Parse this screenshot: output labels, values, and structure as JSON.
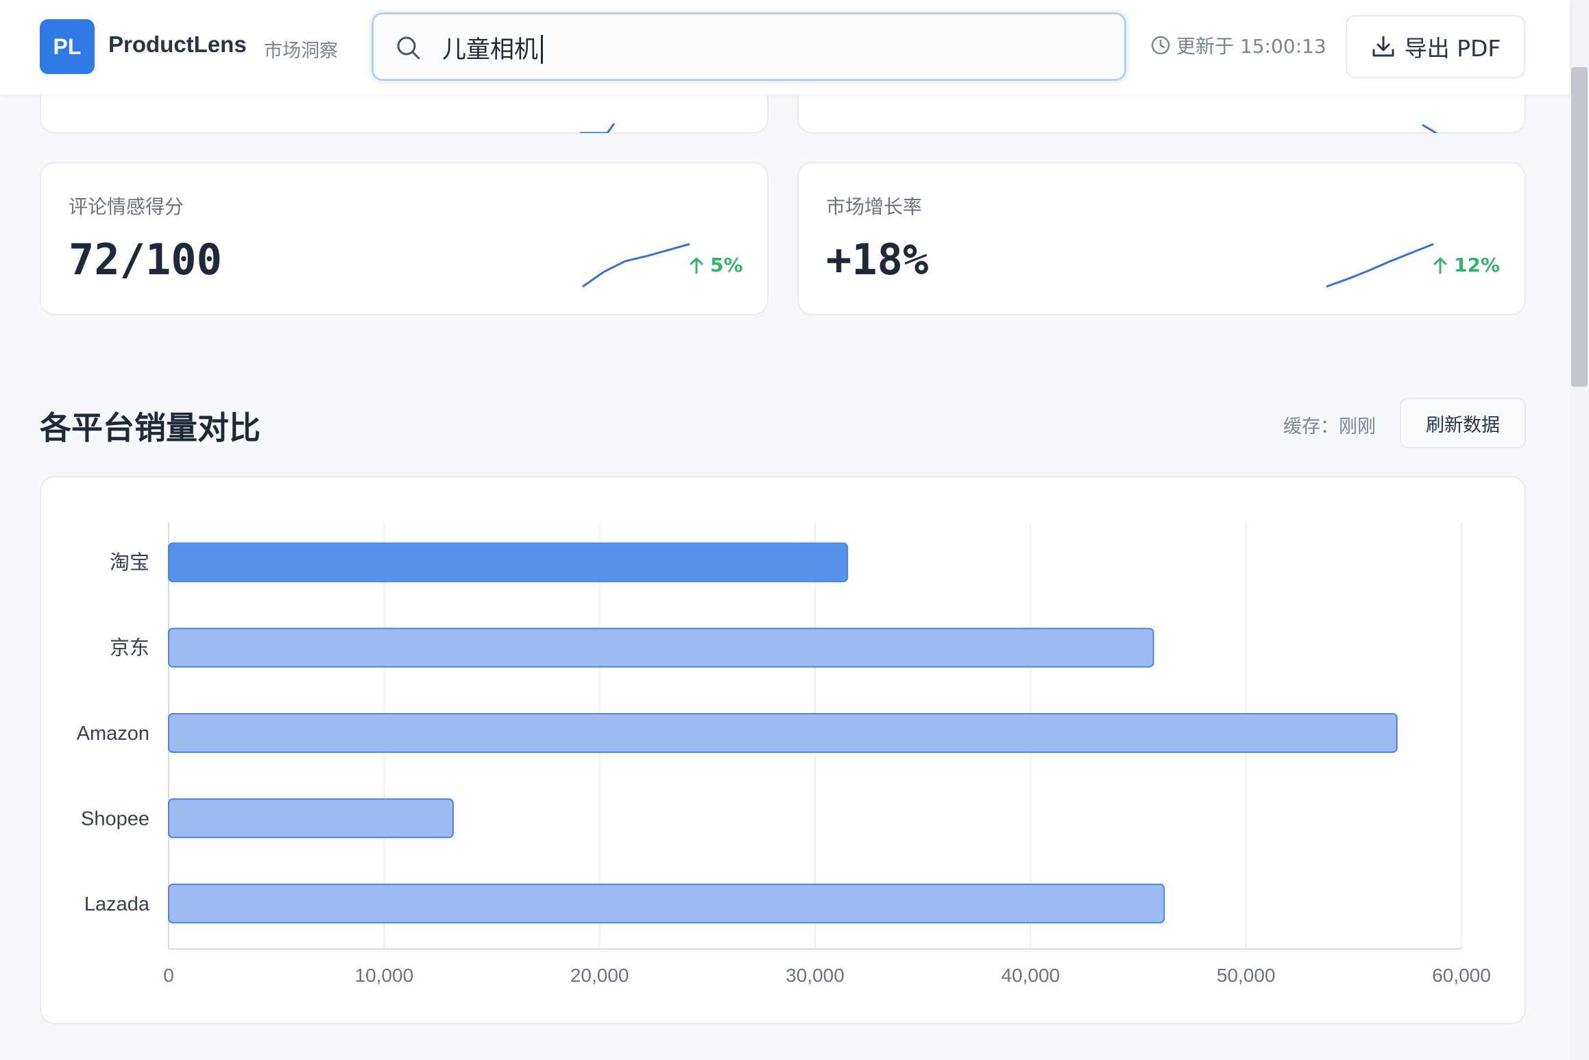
{
  "header": {
    "logo_text": "PL",
    "brand_name": "ProductLens",
    "brand_subtitle": "市场洞察",
    "search": {
      "value": "儿童相机",
      "placeholder": ""
    },
    "updated": "更新于 15:00:13",
    "export_label": "导出 PDF"
  },
  "kpis": [
    {
      "label": "评论情感得分",
      "value": "72/100",
      "trend": "5%",
      "trend_direction": "up",
      "spark": [
        0,
        0.35,
        0.6,
        0.72,
        0.86,
        1
      ]
    },
    {
      "label": "市场增长率",
      "value": "+18%",
      "trend": "12%",
      "trend_direction": "up",
      "spark": [
        0,
        0.18,
        0.38,
        0.6,
        0.8,
        1
      ]
    }
  ],
  "section": {
    "title": "各平台销量对比",
    "cache_label": "缓存：刚刚",
    "refresh_label": "刷新数据"
  },
  "colors": {
    "accent": "#2f7ae5",
    "bar_highlight": "#5592ec",
    "bar_default": "#9cbcf2",
    "bar_stroke": "#4f82dc",
    "trend_up": "#34b46a",
    "spark_line": "#3b6fd6"
  },
  "chart_data": {
    "type": "bar",
    "orientation": "horizontal",
    "categories": [
      "淘宝",
      "京东",
      "Amazon",
      "Shopee",
      "Lazada"
    ],
    "values": [
      31500,
      45700,
      57000,
      13200,
      46200
    ],
    "highlight_index": 0,
    "xlim": [
      0,
      60000
    ],
    "xticks": [
      0,
      10000,
      20000,
      30000,
      40000,
      50000,
      60000
    ],
    "xtick_labels": [
      "0",
      "10,000",
      "20,000",
      "30,000",
      "40,000",
      "50,000",
      "60,000"
    ],
    "grid": "vertical",
    "legend": "none"
  }
}
